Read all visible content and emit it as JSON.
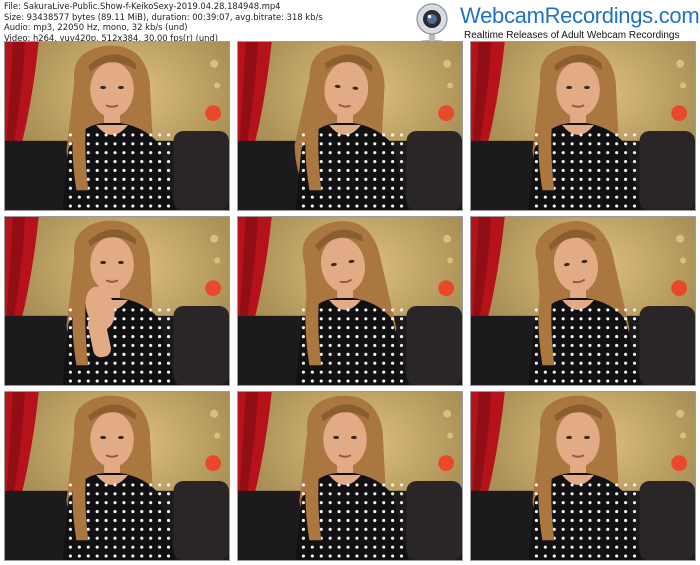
{
  "header": {
    "file_line": "File: SakuraLive-Public.Show-f-KeikoSexy-2019.04.28.184948.mp4",
    "size_line": "Size: 93438577 bytes (89.11 MiB), duration: 00:39:07, avg.bitrate: 318 kb/s",
    "audio_line": "Audio: mp3, 22050 Hz, mono, 32 kb/s (und)",
    "video_line": "Video: h264, yuv420p, 512x384, 30.00 fps(r) (und)"
  },
  "logo": {
    "brand": "WebcamRecordings.com",
    "tagline": "Realtime Releases of Adult Webcam Recordings"
  },
  "colors": {
    "wall": "#c9a85e",
    "curtain": "#b5121b",
    "couch": "#1c1a1c",
    "dress": "#111114",
    "skin": "#e2ab86",
    "hair": "#a9773f",
    "brand_blue": "#1f73c4"
  },
  "thumbnails": [
    {
      "pose": "centered"
    },
    {
      "pose": "looking-down"
    },
    {
      "pose": "centered"
    },
    {
      "pose": "hand-raised"
    },
    {
      "pose": "head-tilted"
    },
    {
      "pose": "head-tilted"
    },
    {
      "pose": "centered"
    },
    {
      "pose": "centered"
    },
    {
      "pose": "centered"
    }
  ]
}
